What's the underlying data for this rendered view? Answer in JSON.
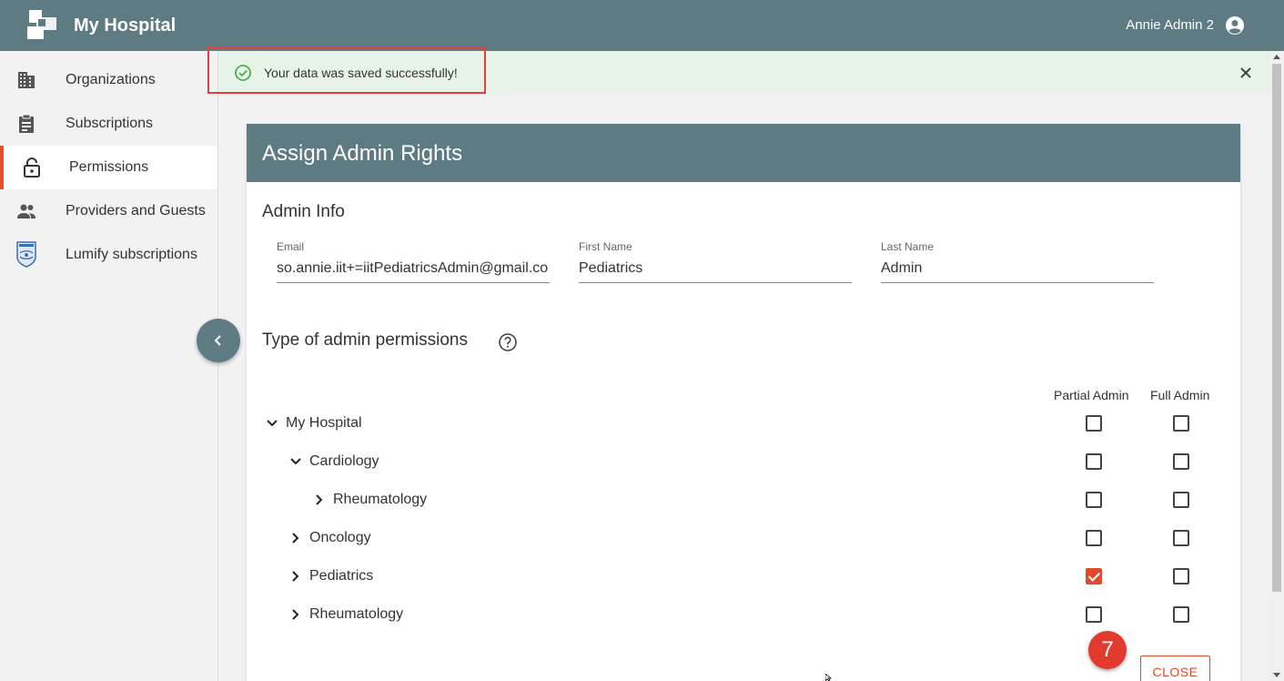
{
  "header": {
    "app_title": "My Hospital",
    "user_name": "Annie Admin 2",
    "logo_icon": "hospital-logo-icon",
    "user_icon": "account-circle-icon"
  },
  "sidebar": {
    "items": [
      {
        "label": "Organizations",
        "icon": "building-icon",
        "active": false
      },
      {
        "label": "Subscriptions",
        "icon": "clipboard-icon",
        "active": false
      },
      {
        "label": "Permissions",
        "icon": "lock-icon",
        "active": true
      },
      {
        "label": "Providers and Guests",
        "icon": "people-icon",
        "active": false
      },
      {
        "label": "Lumify subscriptions",
        "icon": "philips-shield-icon",
        "active": false
      }
    ],
    "collapse_icon": "chevron-left-icon"
  },
  "toast": {
    "message": "Your data was saved successfully!",
    "icon": "check-circle-icon",
    "close_icon": "close-icon"
  },
  "card": {
    "title": "Assign Admin Rights",
    "admin_info_title": "Admin Info",
    "fields": {
      "email": {
        "label": "Email",
        "value": "so.annie.iit+=iitPediatricsAdmin@gmail.co"
      },
      "first_name": {
        "label": "First Name",
        "value": "Pediatrics"
      },
      "last_name": {
        "label": "Last Name",
        "value": "Admin"
      }
    },
    "permissions_title": "Type of admin permissions",
    "help_icon": "help-circle-icon",
    "columns": {
      "partial": "Partial Admin",
      "full": "Full Admin"
    },
    "tree": [
      {
        "label": "My Hospital",
        "level": 0,
        "expanded": true,
        "partial": false,
        "full": false
      },
      {
        "label": "Cardiology",
        "level": 1,
        "expanded": true,
        "partial": false,
        "full": false
      },
      {
        "label": "Rheumatology",
        "level": 2,
        "expanded": false,
        "partial": false,
        "full": false
      },
      {
        "label": "Oncology",
        "level": 1,
        "expanded": false,
        "partial": false,
        "full": false
      },
      {
        "label": "Pediatrics",
        "level": 1,
        "expanded": false,
        "partial": true,
        "full": false
      },
      {
        "label": "Rheumatology",
        "level": 1,
        "expanded": false,
        "partial": false,
        "full": false
      }
    ],
    "close_label": "CLOSE"
  },
  "step_badge": "7",
  "colors": {
    "primary": "#5e7b83",
    "accent": "#e04a2a",
    "toast_bg": "#e8f3e8",
    "success": "#4caf50",
    "highlight": "#e04040"
  }
}
